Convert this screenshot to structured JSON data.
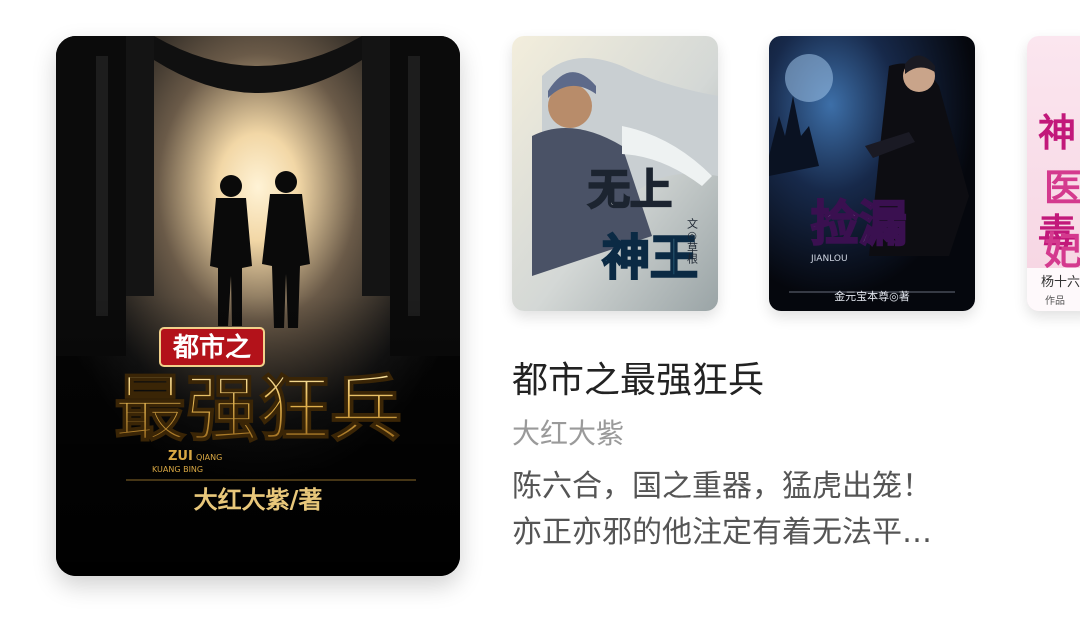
{
  "featured_book": {
    "cover": {
      "series_text": "都市之",
      "title_text": "最强狂兵",
      "pinyin_small": "ZUI",
      "pinyin_line": "KUANG BING",
      "pinyin_side": "QIANG",
      "byline": "大红大紫/著"
    },
    "title": "都市之最强狂兵",
    "author": "大红大紫",
    "description_lines": [
      "陈六合，国之重器，猛虎出笼！",
      "亦正亦邪的他注定有着无法平…"
    ]
  },
  "carousel_books": [
    {
      "cover_title_top": "无上",
      "cover_title_bottom": "神王",
      "cover_credit": "文◎草根"
    },
    {
      "cover_title": "捡漏",
      "cover_pinyin": "JIANLOU",
      "cover_byline": "金元宝本尊◎著"
    },
    {
      "cover_title_chars": "神医毒妃",
      "cover_byline": "杨十六",
      "cover_badge": "作品"
    }
  ],
  "colors": {
    "title": "#222222",
    "author": "#9a9a9a",
    "description": "#555555",
    "featured_gold": "#d8a743",
    "featured_red_badge": "#b3121a"
  }
}
